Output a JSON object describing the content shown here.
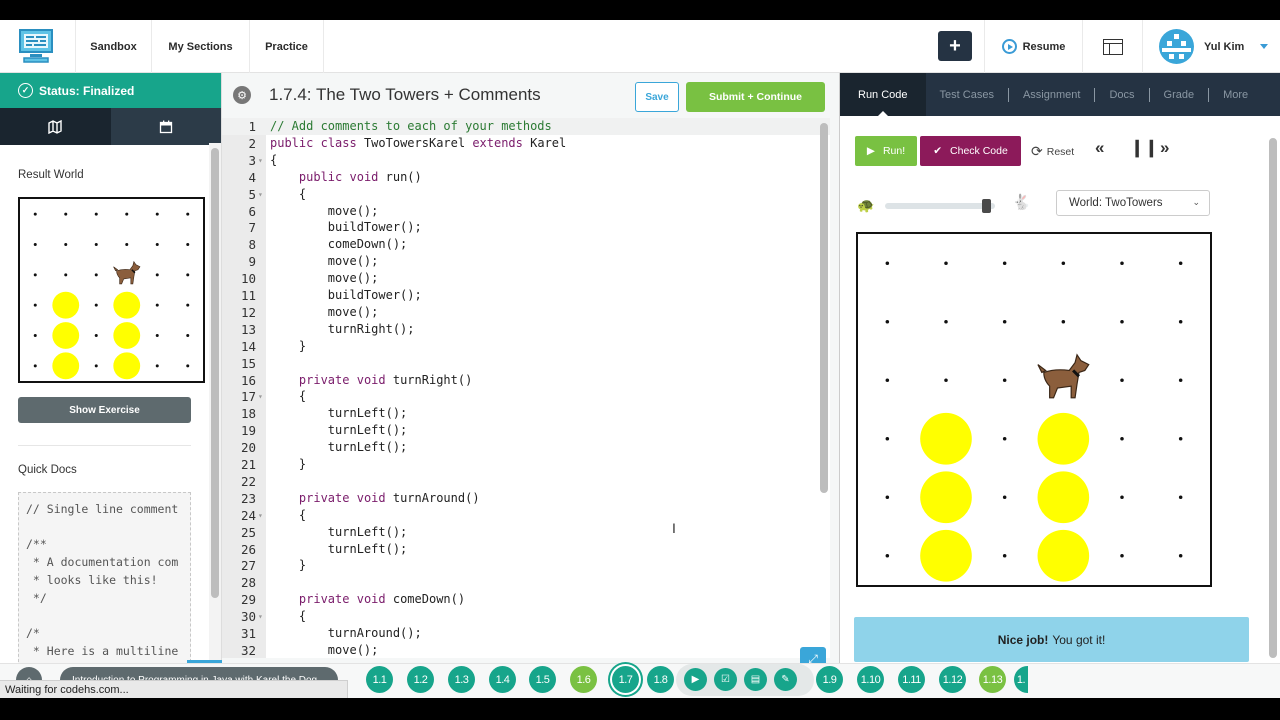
{
  "topnav": {
    "links": [
      "Sandbox",
      "My Sections",
      "Practice"
    ],
    "plus_label": "+",
    "resume_label": "Resume",
    "user_name": "Yul Kim"
  },
  "sidebar": {
    "status_label": "Status: Finalized",
    "result_world_label": "Result World",
    "show_exercise_label": "Show Exercise",
    "quick_docs_label": "Quick Docs",
    "quick_docs_code": "// Single line comment\n\n/**\n * A documentation com\n * looks like this!\n */\n\n/*\n * Here is a multiline"
  },
  "editor": {
    "title": "1.7.4: The Two Towers + Comments",
    "save_label": "Save",
    "submit_label": "Submit + Continue",
    "lines": [
      {
        "n": "1",
        "fold": false,
        "code": "// Add comments to each of your methods",
        "type": "comment"
      },
      {
        "n": "2",
        "fold": false,
        "code": "public class TwoTowersKarel extends Karel",
        "type": "class"
      },
      {
        "n": "3",
        "fold": true,
        "code": "{",
        "type": "plain"
      },
      {
        "n": "4",
        "fold": false,
        "code": "    public void run()",
        "type": "method"
      },
      {
        "n": "5",
        "fold": true,
        "code": "    {",
        "type": "plain"
      },
      {
        "n": "6",
        "fold": false,
        "code": "        move();",
        "type": "plain"
      },
      {
        "n": "7",
        "fold": false,
        "code": "        buildTower();",
        "type": "plain"
      },
      {
        "n": "8",
        "fold": false,
        "code": "        comeDown();",
        "type": "plain"
      },
      {
        "n": "9",
        "fold": false,
        "code": "        move();",
        "type": "plain"
      },
      {
        "n": "10",
        "fold": false,
        "code": "        move();",
        "type": "plain"
      },
      {
        "n": "11",
        "fold": false,
        "code": "        buildTower();",
        "type": "plain"
      },
      {
        "n": "12",
        "fold": false,
        "code": "        move();",
        "type": "plain"
      },
      {
        "n": "13",
        "fold": false,
        "code": "        turnRight();",
        "type": "plain"
      },
      {
        "n": "14",
        "fold": false,
        "code": "    }",
        "type": "plain"
      },
      {
        "n": "15",
        "fold": false,
        "code": "",
        "type": "plain"
      },
      {
        "n": "16",
        "fold": false,
        "code": "    private void turnRight()",
        "type": "method"
      },
      {
        "n": "17",
        "fold": true,
        "code": "    {",
        "type": "plain"
      },
      {
        "n": "18",
        "fold": false,
        "code": "        turnLeft();",
        "type": "plain"
      },
      {
        "n": "19",
        "fold": false,
        "code": "        turnLeft();",
        "type": "plain"
      },
      {
        "n": "20",
        "fold": false,
        "code": "        turnLeft();",
        "type": "plain"
      },
      {
        "n": "21",
        "fold": false,
        "code": "    }",
        "type": "plain"
      },
      {
        "n": "22",
        "fold": false,
        "code": "",
        "type": "plain"
      },
      {
        "n": "23",
        "fold": false,
        "code": "    private void turnAround()",
        "type": "method"
      },
      {
        "n": "24",
        "fold": true,
        "code": "    {",
        "type": "plain"
      },
      {
        "n": "25",
        "fold": false,
        "code": "        turnLeft();",
        "type": "plain"
      },
      {
        "n": "26",
        "fold": false,
        "code": "        turnLeft();",
        "type": "plain"
      },
      {
        "n": "27",
        "fold": false,
        "code": "    }",
        "type": "plain"
      },
      {
        "n": "28",
        "fold": false,
        "code": "",
        "type": "plain"
      },
      {
        "n": "29",
        "fold": false,
        "code": "    private void comeDown()",
        "type": "method"
      },
      {
        "n": "30",
        "fold": true,
        "code": "    {",
        "type": "plain"
      },
      {
        "n": "31",
        "fold": false,
        "code": "        turnAround();",
        "type": "plain"
      },
      {
        "n": "32",
        "fold": false,
        "code": "        move();",
        "type": "plain"
      }
    ]
  },
  "right_panel": {
    "tabs": [
      "Run Code",
      "Test Cases",
      "Assignment",
      "Docs",
      "Grade",
      "More"
    ],
    "active_tab": "Run Code",
    "run_label": "Run!",
    "check_label": "Check Code",
    "reset_label": "Reset",
    "speed_fraction": 0.92,
    "world_select": "World: TwoTowers",
    "feedback_bold": "Nice job!",
    "feedback_text": "You got it!"
  },
  "world": {
    "cols": 6,
    "rows": 6,
    "karel": {
      "col": 4,
      "row": 4,
      "direction": "east"
    },
    "balls": [
      {
        "col": 2,
        "row": 1
      },
      {
        "col": 2,
        "row": 2
      },
      {
        "col": 2,
        "row": 3
      },
      {
        "col": 4,
        "row": 1
      },
      {
        "col": 4,
        "row": 2
      },
      {
        "col": 4,
        "row": 3
      }
    ],
    "ball_color": "#ffff00"
  },
  "bottom": {
    "course_label": "Introduction to Programming in Java with Karel the Dog",
    "units": [
      {
        "label": "1.1",
        "state": "normal"
      },
      {
        "label": "1.2",
        "state": "normal"
      },
      {
        "label": "1.3",
        "state": "normal"
      },
      {
        "label": "1.4",
        "state": "normal"
      },
      {
        "label": "1.5",
        "state": "normal"
      },
      {
        "label": "1.6",
        "state": "done"
      },
      {
        "label": "1.7",
        "state": "current"
      },
      {
        "label": "1.8",
        "state": "normal"
      },
      {
        "label": "1.9",
        "state": "normal"
      },
      {
        "label": "1.10",
        "state": "normal"
      },
      {
        "label": "1.11",
        "state": "normal"
      },
      {
        "label": "1.12",
        "state": "normal"
      },
      {
        "label": "1.13",
        "state": "done"
      },
      {
        "label": "1.",
        "state": "normal"
      }
    ],
    "activities": [
      "video-icon",
      "checkbox-icon",
      "document-icon",
      "pencil-icon"
    ],
    "browser_status": "Waiting for codehs.com..."
  },
  "colors": {
    "teal": "#17a58b",
    "green": "#79c142",
    "purple": "#8c1a5a",
    "blue": "#3aa6d9",
    "navy": "#253343"
  }
}
